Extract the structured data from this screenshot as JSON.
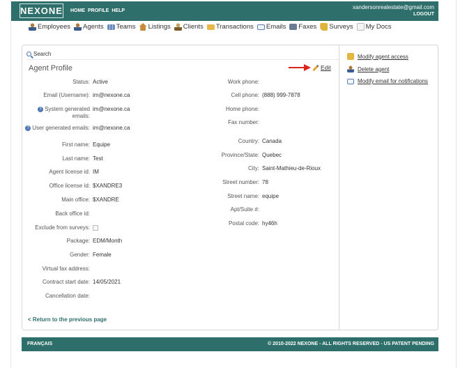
{
  "header": {
    "logo": "NEXONE",
    "nav": [
      "HOME",
      "PROFILE",
      "HELP"
    ],
    "email": "xandersonrealestate@gmail.com",
    "logout": "LOGOUT"
  },
  "mainnav": [
    {
      "label": "Employees",
      "icon": "person-icon"
    },
    {
      "label": "Agents",
      "icon": "person-icon"
    },
    {
      "label": "Teams",
      "icon": "team-icon"
    },
    {
      "label": "Listings",
      "icon": "house-icon"
    },
    {
      "label": "Clients",
      "icon": "client-icon"
    },
    {
      "label": "Transactions",
      "icon": "folder-icon"
    },
    {
      "label": "Emails",
      "icon": "mail-icon"
    },
    {
      "label": "Faxes",
      "icon": "fax-icon"
    },
    {
      "label": "Surveys",
      "icon": "survey-icon"
    },
    {
      "label": "My Docs",
      "icon": "doc-icon"
    }
  ],
  "search": {
    "label": "Search"
  },
  "profile": {
    "title": "Agent Profile",
    "edit": "Edit",
    "left": [
      {
        "label": "Status:",
        "value": "Active"
      },
      {
        "label": "Email (Username):",
        "value": "im@nexone.ca"
      },
      {
        "label": "System generated emails:",
        "value": "im@nexone.ca"
      },
      {
        "label": "User generated emails:",
        "value": "im@nexone.ca"
      },
      {
        "label": "First name:",
        "value": "Equipe"
      },
      {
        "label": "Last name:",
        "value": "Test"
      },
      {
        "label": "Agent license id:",
        "value": "IM"
      },
      {
        "label": "Office license id:",
        "value": "$XANDRE3"
      },
      {
        "label": "Main office:",
        "value": "$XANDRE"
      },
      {
        "label": "Back office id:",
        "value": ""
      },
      {
        "label": "Exclude from surveys:",
        "value": ""
      },
      {
        "label": "Package:",
        "value": "EDM/Month"
      },
      {
        "label": "Gender:",
        "value": "Female"
      },
      {
        "label": "Virtual fax address:",
        "value": ""
      },
      {
        "label": "Contract start date:",
        "value": "14/05/2021"
      },
      {
        "label": "Cancellation date:",
        "value": ""
      }
    ],
    "right": [
      {
        "label": "Work phone:",
        "value": ""
      },
      {
        "label": "Cell phone:",
        "value": "(888) 999-7878"
      },
      {
        "label": "Home phone:",
        "value": ""
      },
      {
        "label": "Fax number:",
        "value": ""
      },
      {
        "label": "Country:",
        "value": "Canada"
      },
      {
        "label": "Province/State:",
        "value": "Quebec"
      },
      {
        "label": "City:",
        "value": "Saint-Mathieu-de-Rioux"
      },
      {
        "label": "Street number:",
        "value": "78"
      },
      {
        "label": "Street name:",
        "value": "equipe"
      },
      {
        "label": "Apt/Suite #:",
        "value": ""
      },
      {
        "label": "Postal code:",
        "value": "hy46h"
      }
    ],
    "back": "< Return to the previous page"
  },
  "actions": [
    {
      "label": "Modify agent access",
      "icon": "lock-icon"
    },
    {
      "label": "Delete agent",
      "icon": "delete-agent-icon"
    },
    {
      "label": "Modify email for notifications",
      "icon": "envelope-icon"
    }
  ],
  "footer": {
    "lang": "FRANÇAIS",
    "copyright": "© 2010-2022 NEXONE - ALL RIGHTS RESERVED - US PATENT PENDING"
  },
  "colors": {
    "brand": "#2e6f6b",
    "arrow": "#d9251c"
  }
}
